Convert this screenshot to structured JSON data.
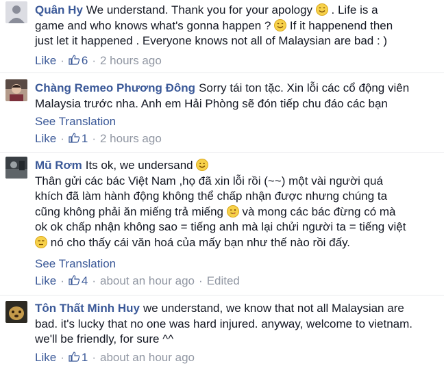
{
  "comments": [
    {
      "author": "Quân Hy",
      "line1": "We understand. Thank you for your apology",
      "line1b": ". Life is a",
      "line2": "game and who knows what's gonna happen ?",
      "line2b": "If it happenend then",
      "line3": "just let it happened . Everyone knows not all of Malaysian are bad : )",
      "like_label": "Like",
      "like_count": "6",
      "time": "2 hours ago"
    },
    {
      "author": "Chàng Remeo Phương Đông",
      "line1": "Sorry tái ton tặc. Xin lỗi các cổ động viên",
      "line2": "Malaysia trước nha. Anh em Hải Phòng sẽ đón tiếp chu đáo các bạn",
      "see_translation": "See Translation",
      "like_label": "Like",
      "like_count": "1",
      "time": "2 hours ago"
    },
    {
      "author": "Mũ Rơm",
      "line1": "Its ok, we undersand",
      "line2": "Thân gửi các bác Việt Nam ,họ đã xin lỗi rồi (~~) một vài người quá",
      "line3": "khích đã làm hành động không thể chấp nhận được nhưng chúng ta",
      "line4a": "cũng không phải ăn miếng trả miếng",
      "line4b": "và mong các bác đừng có mà",
      "line5": "ok ok chấp nhận không sao = tiếng anh mà lại chửi người ta = tiếng việt",
      "line6": "nó cho thấy cái văn hoá của mấy bạn như thế nào rồi đấy.",
      "see_translation": "See Translation",
      "like_label": "Like",
      "like_count": "4",
      "time": "about an hour ago",
      "edited": "Edited"
    },
    {
      "author": "Tôn Thất Minh Huy",
      "line1": "we understand, we know that not all Malaysian are",
      "line2": "bad. it's lucky that no one was hard injured. anyway, welcome to vietnam.",
      "line3": "we'll be friendly, for sure ^^",
      "like_label": "Like",
      "like_count": "1",
      "time": "about an hour ago"
    }
  ],
  "separator": "·",
  "colors": {
    "link": "#3b5998",
    "text": "#141823",
    "meta": "#9197a3",
    "emoji": "#f7d14a"
  }
}
